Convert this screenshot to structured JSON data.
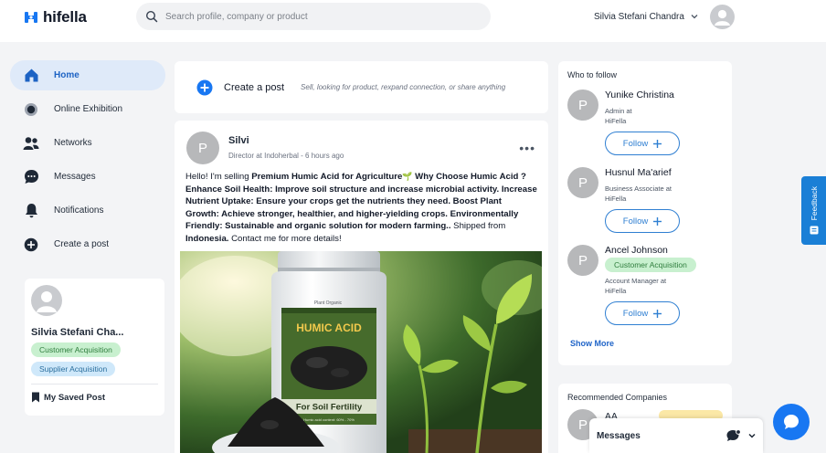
{
  "header": {
    "logo_text": "hifella",
    "search_placeholder": "Search profile, company or product",
    "user_name": "Silvia Stefani Chandra"
  },
  "sidebar": {
    "items": [
      {
        "label": "Home",
        "icon": "home-icon",
        "active": true
      },
      {
        "label": "Online Exhibition",
        "icon": "exhibition-icon"
      },
      {
        "label": "Networks",
        "icon": "networks-icon"
      },
      {
        "label": "Messages",
        "icon": "messages-icon"
      },
      {
        "label": "Notifications",
        "icon": "bell-icon"
      },
      {
        "label": "Create a post",
        "icon": "plus-circle-icon"
      }
    ],
    "profile": {
      "name": "Silvia Stefani Cha...",
      "tags": [
        "Customer Acquisition",
        "Supplier Acquisition"
      ],
      "saved_label": "My Saved Post"
    }
  },
  "create_post": {
    "label": "Create a post",
    "hint": "Sell, looking for product, rexpand connection, or share anything"
  },
  "post": {
    "avatar_letter": "P",
    "author": "Silvi",
    "meta": "Director at Indoherbal - 6 hours ago",
    "more": "•••",
    "body": {
      "intro": "Hello! I'm selling ",
      "product": "Premium Humic Acid for Agriculture",
      "leaf": "🌱",
      "why": " Why Choose Humic Acid ? Enhance Soil Health: Improve soil structure and increase microbial activity. Increase Nutrient Uptake: Ensure your crops get the nutrients they need. Boost Plant Growth: Achieve stronger, healthier, and higher-yielding crops. Environmentally Friendly: Sustainable and organic solution for modern farming..",
      "shipped_pre": " Shipped from ",
      "country": "Indonesia.",
      "closing": " Contact me for more details!"
    },
    "image": {
      "label_title": "HUMIC ACID",
      "label_bottom": "For Soil Fertility",
      "label_brand": "Plant Organic",
      "label_fine": "Humic acid content: 60% - 70%"
    }
  },
  "who_to_follow": {
    "title": "Who to follow",
    "people": [
      {
        "avatar_letter": "P",
        "name": "Yunike Christina",
        "role_line1": "Admin at",
        "role_line2": "HiFella",
        "tag": ""
      },
      {
        "avatar_letter": "P",
        "name": "Husnul Ma'arief",
        "role_line1": "Business Associate at",
        "role_line2": "HiFella",
        "tag": ""
      },
      {
        "avatar_letter": "P",
        "name": "Ancel Johnson",
        "role_line1": "Account Manager at",
        "role_line2": "HiFella",
        "tag": "Customer Acquisition"
      }
    ],
    "follow_label": "Follow",
    "show_more": "Show More"
  },
  "recommended": {
    "title": "Recommended Companies",
    "avatar_letter": "P",
    "company": "AA SPORT"
  },
  "messages_bar": {
    "label": "Messages"
  },
  "feedback": {
    "label": "Feedback"
  },
  "colors": {
    "accent": "#1877f2",
    "active_bg": "#dfeaf9",
    "tag_green": "#c8f0cf",
    "tag_blue": "#cfe8fa"
  }
}
